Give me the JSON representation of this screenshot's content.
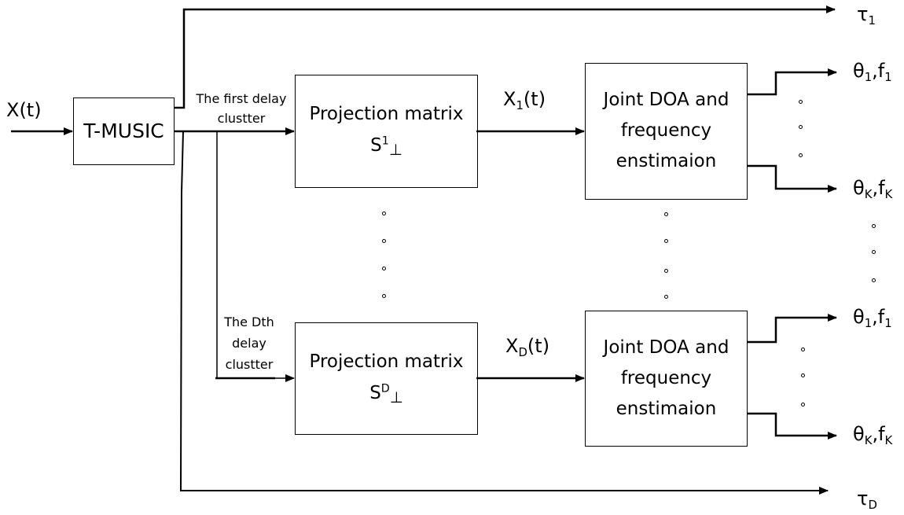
{
  "diagram": {
    "input_label": {
      "main": "X(t)"
    },
    "tmusic_block": {
      "label": "T-MUSIC"
    },
    "first_cluster_label": {
      "line1": "The first delay",
      "line2": "clustter"
    },
    "dth_cluster_label": {
      "line1": "The Dth",
      "line2": "delay",
      "line3": "clustter"
    },
    "projection_block_1": {
      "title": "Projection matrix",
      "symbol": "S",
      "sup": "1",
      "perp": "⊥"
    },
    "projection_block_d": {
      "title": "Projection matrix",
      "symbol": "S",
      "sup": "D",
      "perp": "⊥"
    },
    "signal_1": {
      "main": "X",
      "sub": "1",
      "suffix": "(t)"
    },
    "signal_d": {
      "main": "X",
      "sub": "D",
      "suffix": "(t)"
    },
    "joint_block_1": {
      "line1": "Joint DOA and",
      "line2": "frequency",
      "line3": "enstimaion"
    },
    "joint_block_d": {
      "line1": "Joint DOA and",
      "line2": "frequency",
      "line3": "enstimaion"
    },
    "tau_1": {
      "main": "τ",
      "sub": "1"
    },
    "tau_d": {
      "main": "τ",
      "sub": "D"
    },
    "outputs_group_1": [
      {
        "theta": "θ",
        "theta_sub": "1",
        "sep": ",",
        "f": "f",
        "f_sub": "1"
      },
      {
        "theta": "θ",
        "theta_sub": "K",
        "sep": ",",
        "f": "f",
        "f_sub": "K"
      }
    ],
    "outputs_group_d": [
      {
        "theta": "θ",
        "theta_sub": "1",
        "sep": ",",
        "f": "f",
        "f_sub": "1"
      },
      {
        "theta": "θ",
        "theta_sub": "K",
        "sep": ",",
        "f": "f",
        "f_sub": "K"
      }
    ],
    "ellipsis_symbol": "∘"
  }
}
